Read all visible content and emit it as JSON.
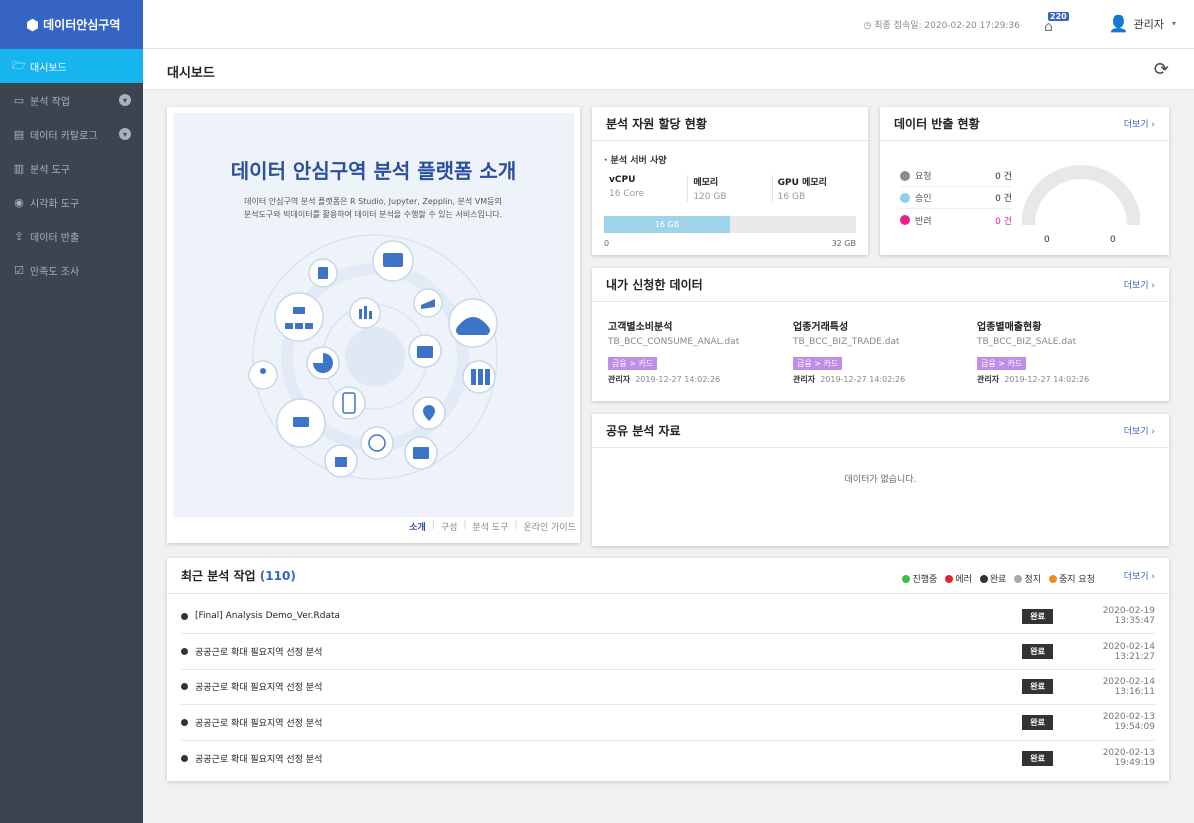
{
  "app": {
    "logo": "데이터안심구역"
  },
  "sidebar": {
    "items": [
      {
        "label": "대시보드",
        "icon": "folder-open-icon",
        "active": true
      },
      {
        "label": "분석 작업",
        "icon": "inbox-icon",
        "expandable": true
      },
      {
        "label": "데이터 카탈로그",
        "icon": "document-icon",
        "expandable": true
      },
      {
        "label": "분석 도구",
        "icon": "chart-icon"
      },
      {
        "label": "시각화 도구",
        "icon": "eye-icon"
      },
      {
        "label": "데이터 반출",
        "icon": "export-icon"
      },
      {
        "label": "만족도 조사",
        "icon": "checklist-icon"
      }
    ]
  },
  "header": {
    "last_login": "최종 접속일: 2020-02-20 17:29:36",
    "notification_count": "220",
    "user": "관리자"
  },
  "page": {
    "title": "대시보드"
  },
  "intro": {
    "title": "데이터 안심구역 분석 플랫폼 소개",
    "desc_line1": "데이터 안심구역 분석 플랫폼은 R Studio, Jupyter, Zepplin, 분석 VM등의",
    "desc_line2": "분석도구와 빅데이터를 활용하여 데이터 분석을 수행할 수 있는 서비스입니다.",
    "tabs": [
      "소개",
      "구성",
      "분석 도구",
      "온라인 가이드"
    ]
  },
  "resource": {
    "title": "분석 자원 할당 현황",
    "spec_heading": "· 분석 서버 사양",
    "specs": [
      {
        "label": "vCPU",
        "value": "16 Core"
      },
      {
        "label": "메모리",
        "value": "120 GB"
      },
      {
        "label": "GPU 메모리",
        "value": "16 GB"
      }
    ],
    "bar_label": "16 GB",
    "bar_fraction": 0.5,
    "bar_min": "0",
    "bar_max": "32 GB"
  },
  "export": {
    "title": "데이터 반출 현황",
    "more": "더보기 ›",
    "rows": [
      {
        "label": "요청",
        "count": "0 건",
        "color": "#8c8c8c"
      },
      {
        "label": "승인",
        "count": "0 건",
        "color": "#8fd0ea"
      },
      {
        "label": "반려",
        "count": "0 건",
        "color": "#e91e8c"
      }
    ],
    "gauge_left": "0",
    "gauge_right": "0"
  },
  "my_data": {
    "title": "내가 신청한 데이터",
    "more": "더보기 ›",
    "items": [
      {
        "name": "고객별소비분석",
        "file": "TB_BCC_CONSUME_ANAL.dat",
        "tag": "금융 > 카드",
        "owner": "관리자",
        "time": "2019-12-27 14:02:26"
      },
      {
        "name": "업종거래특성",
        "file": "TB_BCC_BIZ_TRADE.dat",
        "tag": "금융 > 카드",
        "owner": "관리자",
        "time": "2019-12-27 14:02:26"
      },
      {
        "name": "업종별매출현황",
        "file": "TB_BCC_BIZ_SALE.dat",
        "tag": "금융 > 카드",
        "owner": "관리자",
        "time": "2019-12-27 14:02:26"
      }
    ]
  },
  "shared": {
    "title": "공유 분석 자료",
    "more": "더보기 ›",
    "empty": "데이터가 없습니다."
  },
  "recent": {
    "title": "최근 분석 작업",
    "count": "(110)",
    "more": "더보기 ›",
    "legend": [
      {
        "label": "진행중",
        "color": "#39c23f"
      },
      {
        "label": "에러",
        "color": "#e8232a"
      },
      {
        "label": "완료",
        "color": "#333333"
      },
      {
        "label": "정지",
        "color": "#aaaaaa"
      },
      {
        "label": "중지 요청",
        "color": "#f08a24"
      }
    ],
    "rows": [
      {
        "name": "[Final] Analysis Demo_Ver.Rdata",
        "status": "완료",
        "time": "2020-02-19 13:35:47"
      },
      {
        "name": "공공근로 확대 필요지역 선정 분석",
        "status": "완료",
        "time": "2020-02-14 13:21:27"
      },
      {
        "name": "공공근로 확대 필요지역 선정 분석",
        "status": "완료",
        "time": "2020-02-14 13:16:11"
      },
      {
        "name": "공공근로 확대 필요지역 선정 분석",
        "status": "완료",
        "time": "2020-02-13 19:54:09"
      },
      {
        "name": "공공근로 확대 필요지역 선정 분석",
        "status": "완료",
        "time": "2020-02-13 19:49:19"
      }
    ]
  }
}
